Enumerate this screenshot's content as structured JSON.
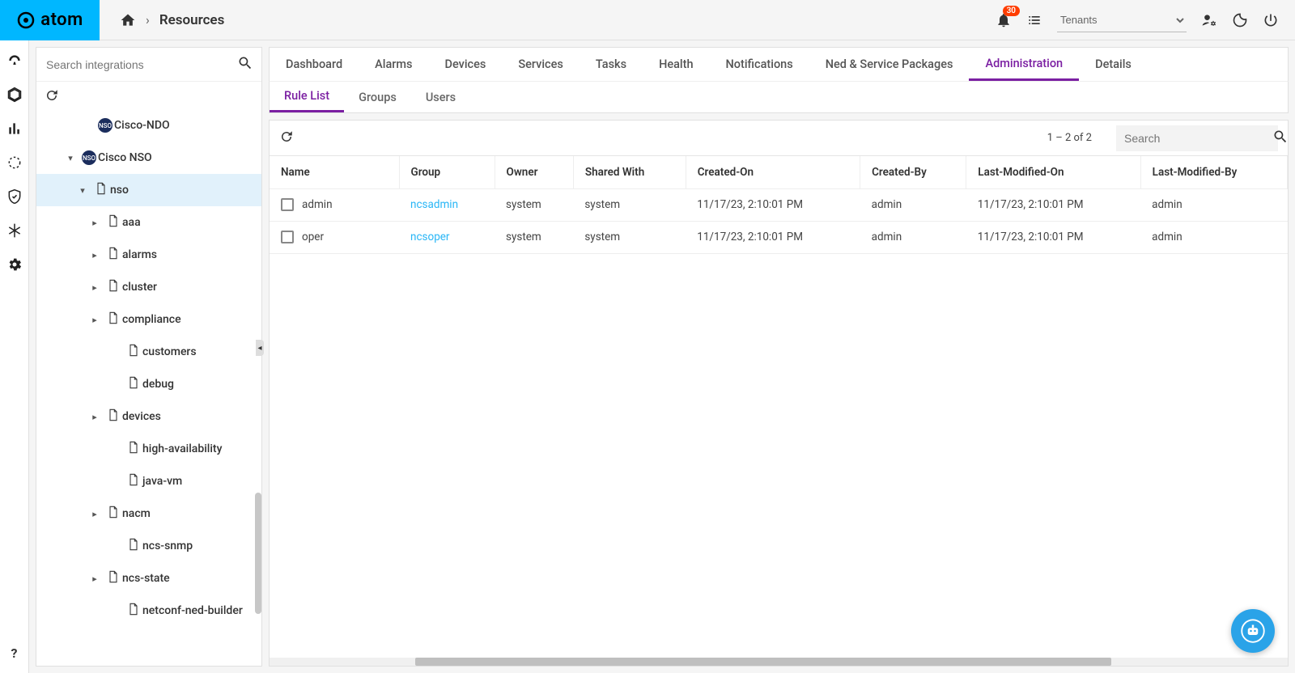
{
  "brand": {
    "name": "atom"
  },
  "breadcrumb": {
    "page": "Resources"
  },
  "header": {
    "badge_count": "30",
    "tenant_label": "Tenants"
  },
  "tree": {
    "search_placeholder": "Search integrations",
    "items": [
      {
        "label": "Cisco-NDO",
        "indent": 50,
        "chevron": "",
        "icon": "circle",
        "selected": false
      },
      {
        "label": "Cisco NSO",
        "indent": 30,
        "chevron": "down",
        "icon": "circle",
        "selected": false
      },
      {
        "label": "nso",
        "indent": 45,
        "chevron": "down",
        "icon": "doc",
        "selected": true
      },
      {
        "label": "aaa",
        "indent": 60,
        "chevron": "right",
        "icon": "doc",
        "selected": false
      },
      {
        "label": "alarms",
        "indent": 60,
        "chevron": "right",
        "icon": "doc",
        "selected": false
      },
      {
        "label": "cluster",
        "indent": 60,
        "chevron": "right",
        "icon": "doc",
        "selected": false
      },
      {
        "label": "compliance",
        "indent": 60,
        "chevron": "right",
        "icon": "doc",
        "selected": false
      },
      {
        "label": "customers",
        "indent": 85,
        "chevron": "",
        "icon": "doc",
        "selected": false
      },
      {
        "label": "debug",
        "indent": 85,
        "chevron": "",
        "icon": "doc",
        "selected": false
      },
      {
        "label": "devices",
        "indent": 60,
        "chevron": "right",
        "icon": "doc",
        "selected": false
      },
      {
        "label": "high-availability",
        "indent": 85,
        "chevron": "",
        "icon": "doc",
        "selected": false
      },
      {
        "label": "java-vm",
        "indent": 85,
        "chevron": "",
        "icon": "doc",
        "selected": false
      },
      {
        "label": "nacm",
        "indent": 60,
        "chevron": "right",
        "icon": "doc",
        "selected": false
      },
      {
        "label": "ncs-snmp",
        "indent": 85,
        "chevron": "",
        "icon": "doc",
        "selected": false
      },
      {
        "label": "ncs-state",
        "indent": 60,
        "chevron": "right",
        "icon": "doc",
        "selected": false
      },
      {
        "label": "netconf-ned-builder",
        "indent": 85,
        "chevron": "",
        "icon": "doc",
        "selected": false
      }
    ]
  },
  "tabs": {
    "items": [
      "Dashboard",
      "Alarms",
      "Devices",
      "Services",
      "Tasks",
      "Health",
      "Notifications",
      "Ned & Service Packages",
      "Administration",
      "Details"
    ],
    "active": "Administration"
  },
  "subtabs": {
    "items": [
      "Rule List",
      "Groups",
      "Users"
    ],
    "active": "Rule List"
  },
  "table": {
    "range_text": "1 – 2 of 2",
    "search_placeholder": "Search",
    "columns": [
      "Name",
      "Group",
      "Owner",
      "Shared With",
      "Created-On",
      "Created-By",
      "Last-Modified-On",
      "Last-Modified-By"
    ],
    "rows": [
      {
        "name": "admin",
        "group": "ncsadmin",
        "owner": "system",
        "shared": "system",
        "created_on": "11/17/23, 2:10:01 PM",
        "created_by": "admin",
        "modified_on": "11/17/23, 2:10:01 PM",
        "modified_by": "admin"
      },
      {
        "name": "oper",
        "group": "ncsoper",
        "owner": "system",
        "shared": "system",
        "created_on": "11/17/23, 2:10:01 PM",
        "created_by": "admin",
        "modified_on": "11/17/23, 2:10:01 PM",
        "modified_by": "admin"
      }
    ]
  }
}
